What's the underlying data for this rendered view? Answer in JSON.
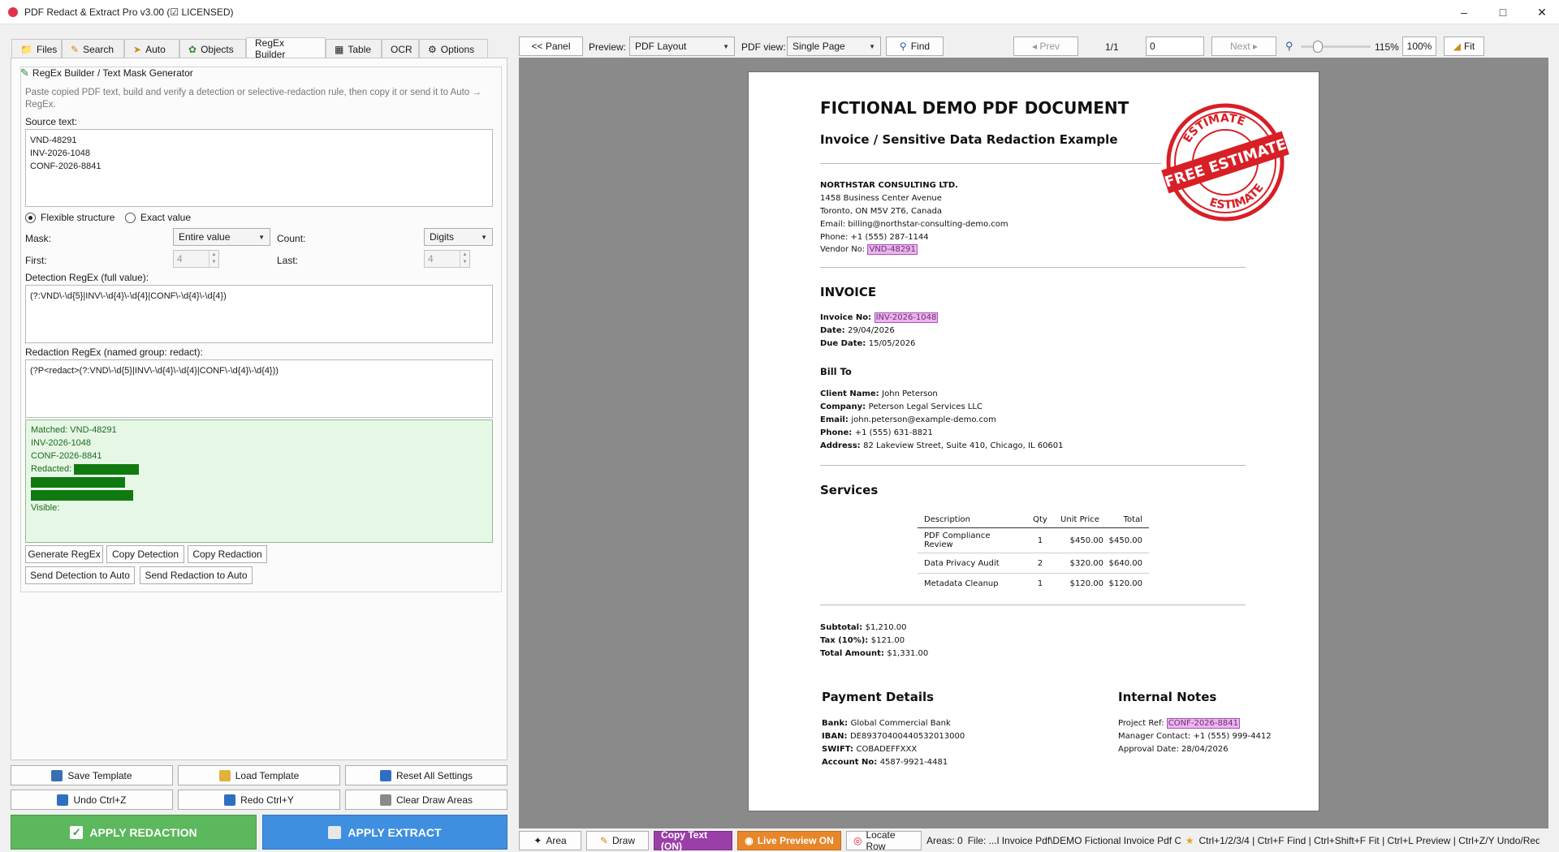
{
  "window": {
    "title": "PDF Redact & Extract Pro v3.00 (☑ LICENSED)",
    "minimize": "–",
    "maximize": "□",
    "close": "✕"
  },
  "tabs": [
    "Files",
    "Search",
    "Auto",
    "Objects",
    "RegEx Builder",
    "Table",
    "OCR",
    "Options"
  ],
  "builder": {
    "title": "RegEx Builder / Text Mask Generator",
    "hint": "Paste copied PDF text, build and verify a detection or selective-redaction rule, then copy it or send it to Auto → RegEx.",
    "source_label": "Source text:",
    "source_text": "VND-48291\nINV-2026-1048\nCONF-2026-8841",
    "radio_flexible": "Flexible structure",
    "radio_exact": "Exact value",
    "mask_label": "Mask:",
    "mask_value": "Entire value",
    "count_label": "Count:",
    "count_value": "Digits",
    "first_label": "First:",
    "first_value": "4",
    "last_label": "Last:",
    "last_value": "4",
    "detection_label": "Detection RegEx (full value):",
    "detection_value": "(?:VND\\-\\d{5}|INV\\-\\d{4}\\-\\d{4}|CONF\\-\\d{4}\\-\\d{4})",
    "redaction_label": "Redaction RegEx (named group: redact):",
    "redaction_value": "(?P<redact>(?:VND\\-\\d{5}|INV\\-\\d{4}\\-\\d{4}|CONF\\-\\d{4}\\-\\d{4}))",
    "match_line1": "Matched:  VND-48291",
    "match_line2": "INV-2026-1048",
    "match_line3": "CONF-2026-8841",
    "redacted_label": "Redacted:",
    "visible_label": "Visible:",
    "btn_generate": "Generate RegEx",
    "btn_copy_detection": "Copy Detection",
    "btn_copy_redaction": "Copy Redaction",
    "btn_send_detection": "Send Detection to Auto",
    "btn_send_redaction": "Send Redaction to Auto"
  },
  "bottom": {
    "save_template": "Save Template",
    "load_template": "Load Template",
    "reset_all": "Reset All Settings",
    "undo": "Undo  Ctrl+Z",
    "redo": "Redo  Ctrl+Y",
    "clear_draw": "Clear Draw Areas",
    "apply_redaction": "APPLY REDACTION",
    "apply_extract": "APPLY EXTRACT"
  },
  "toolbar": {
    "panel": "<< Panel",
    "preview_label": "Preview:",
    "preview_value": "PDF Layout",
    "pdfview_label": "PDF view:",
    "pdfview_value": "Single Page",
    "find": "Find",
    "prev": "◂ Prev",
    "page_counter": "1/1",
    "page_input": "0",
    "next": "Next ▸",
    "zoom_level": 115,
    "zoom_text": "115%",
    "zoom_100": "100%",
    "fit": "Fit"
  },
  "document": {
    "heading": "FICTIONAL DEMO PDF DOCUMENT",
    "subheading": "Invoice / Sensitive Data Redaction Example",
    "company": "NORTHSTAR CONSULTING LTD.",
    "addr1": "1458 Business Center Avenue",
    "addr2": "Toronto, ON M5V 2T6, Canada",
    "email": "Email: billing@northstar-consulting-demo.com",
    "phone": "Phone: +1 (555) 287-1144",
    "vendor_label": "Vendor No: ",
    "vendor_no": "VND-48291",
    "invoice_heading": "INVOICE",
    "invoice_no_label": "Invoice No: ",
    "invoice_no": "INV-2026-1048",
    "date_label": "Date: ",
    "date": "29/04/2026",
    "due_label": "Due Date: ",
    "due": "15/05/2026",
    "billto_heading": "Bill To",
    "client_label": "Client Name: ",
    "client": "John Peterson",
    "company_label": "Company: ",
    "client_company": "Peterson Legal Services LLC",
    "cemail_label": "Email: ",
    "cemail": "john.peterson@example-demo.com",
    "cphone_label": "Phone: ",
    "cphone": "+1 (555) 631-8821",
    "caddr_label": "Address: ",
    "caddr": "82 Lakeview Street, Suite 410, Chicago, IL 60601",
    "services_heading": "Services",
    "services_columns": [
      "Description",
      "Qty",
      "Unit Price",
      "Total"
    ],
    "services_rows": [
      [
        "PDF Compliance Review",
        "1",
        "$450.00",
        "$450.00"
      ],
      [
        "Data Privacy Audit",
        "2",
        "$320.00",
        "$640.00"
      ],
      [
        "Metadata Cleanup",
        "1",
        "$120.00",
        "$120.00"
      ]
    ],
    "subtotal_label": "Subtotal: ",
    "subtotal": "$1,210.00",
    "tax_label": "Tax (10%): ",
    "tax": "$121.00",
    "total_label": "Total Amount: ",
    "total": "$1,331.00",
    "payment_heading": "Payment Details",
    "bank_label": "Bank: ",
    "bank": "Global Commercial Bank",
    "iban_label": "IBAN: ",
    "iban": "DE89370400440532013000",
    "swift_label": "SWIFT: ",
    "swift": "COBADEFFXXX",
    "account_label": "Account No: ",
    "account": "4587-9921-4481",
    "notes_heading": "Internal Notes",
    "project_label": "Project Ref: ",
    "project": "CONF-2026-8841",
    "manager": "Manager Contact: +1 (555) 999-4412",
    "approval": "Approval Date: 28/04/2026",
    "stamp_top": "ESTIMATE",
    "stamp_middle": "FREE ESTIMATE",
    "stamp_bottom": "ESTIMATE"
  },
  "statusbar": {
    "area": "Area",
    "draw": "Draw",
    "copy_text": "Copy Text (ON)",
    "live_preview": "Live Preview ON",
    "locate_row": "Locate Row",
    "areas": "Areas: 0",
    "file": "File: ...l Invoice Pdf\\DEMO Fictional Invoice Pdf C",
    "shortcuts": "Ctrl+1/2/3/4 | Ctrl+F Find | Ctrl+Shift+F Fit | Ctrl+L Preview | Ctrl+Z/Y Undo/Red"
  },
  "colors": {
    "accent_green": "#5cb85c",
    "accent_blue": "#3f8fe0",
    "copy_text_bg": "#9b3fa8",
    "live_preview_bg": "#e8862a",
    "highlight": "#eab5ee",
    "stamp_red": "#d81f26"
  }
}
